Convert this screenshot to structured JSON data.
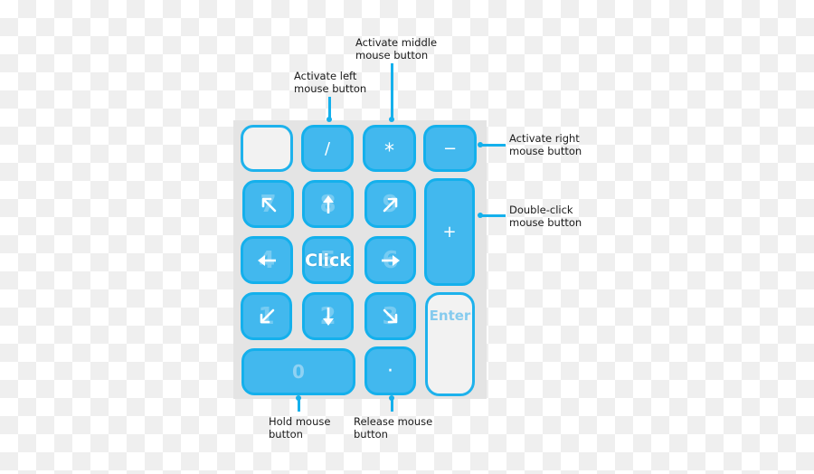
{
  "keypad": {
    "keys": {
      "blank": {
        "label": ""
      },
      "divide": {
        "label": "/"
      },
      "multiply": {
        "label": "*"
      },
      "minus": {
        "label": "−"
      },
      "k7": {
        "number": "7",
        "icon": "arrow-up-left"
      },
      "k8": {
        "number": "8",
        "icon": "arrow-up"
      },
      "k9": {
        "number": "9",
        "icon": "arrow-up-right"
      },
      "plus": {
        "label": "+"
      },
      "k4": {
        "number": "4",
        "icon": "arrow-left"
      },
      "k5": {
        "number": "5",
        "label": "Click"
      },
      "k6": {
        "number": "6",
        "icon": "arrow-right"
      },
      "k1": {
        "number": "1",
        "icon": "arrow-down-left"
      },
      "k2": {
        "number": "2",
        "icon": "arrow-down"
      },
      "k3": {
        "number": "3",
        "icon": "arrow-down-right"
      },
      "enter": {
        "label": "Enter"
      },
      "k0": {
        "label": "0"
      },
      "decimal": {
        "label": "·"
      }
    }
  },
  "annotations": {
    "left": "Activate left\nmouse button",
    "middle": "Activate middle\nmouse button",
    "right": "Activate right\nmouse button",
    "double": "Double-click\nmouse button",
    "hold": "Hold mouse\nbutton",
    "release": "Release mouse\nbutton"
  },
  "colors": {
    "key_fill": "#42b8ee",
    "key_border": "#14b0ec",
    "panel": "#e4e4e4",
    "blank_key": "#f2f2f2"
  }
}
